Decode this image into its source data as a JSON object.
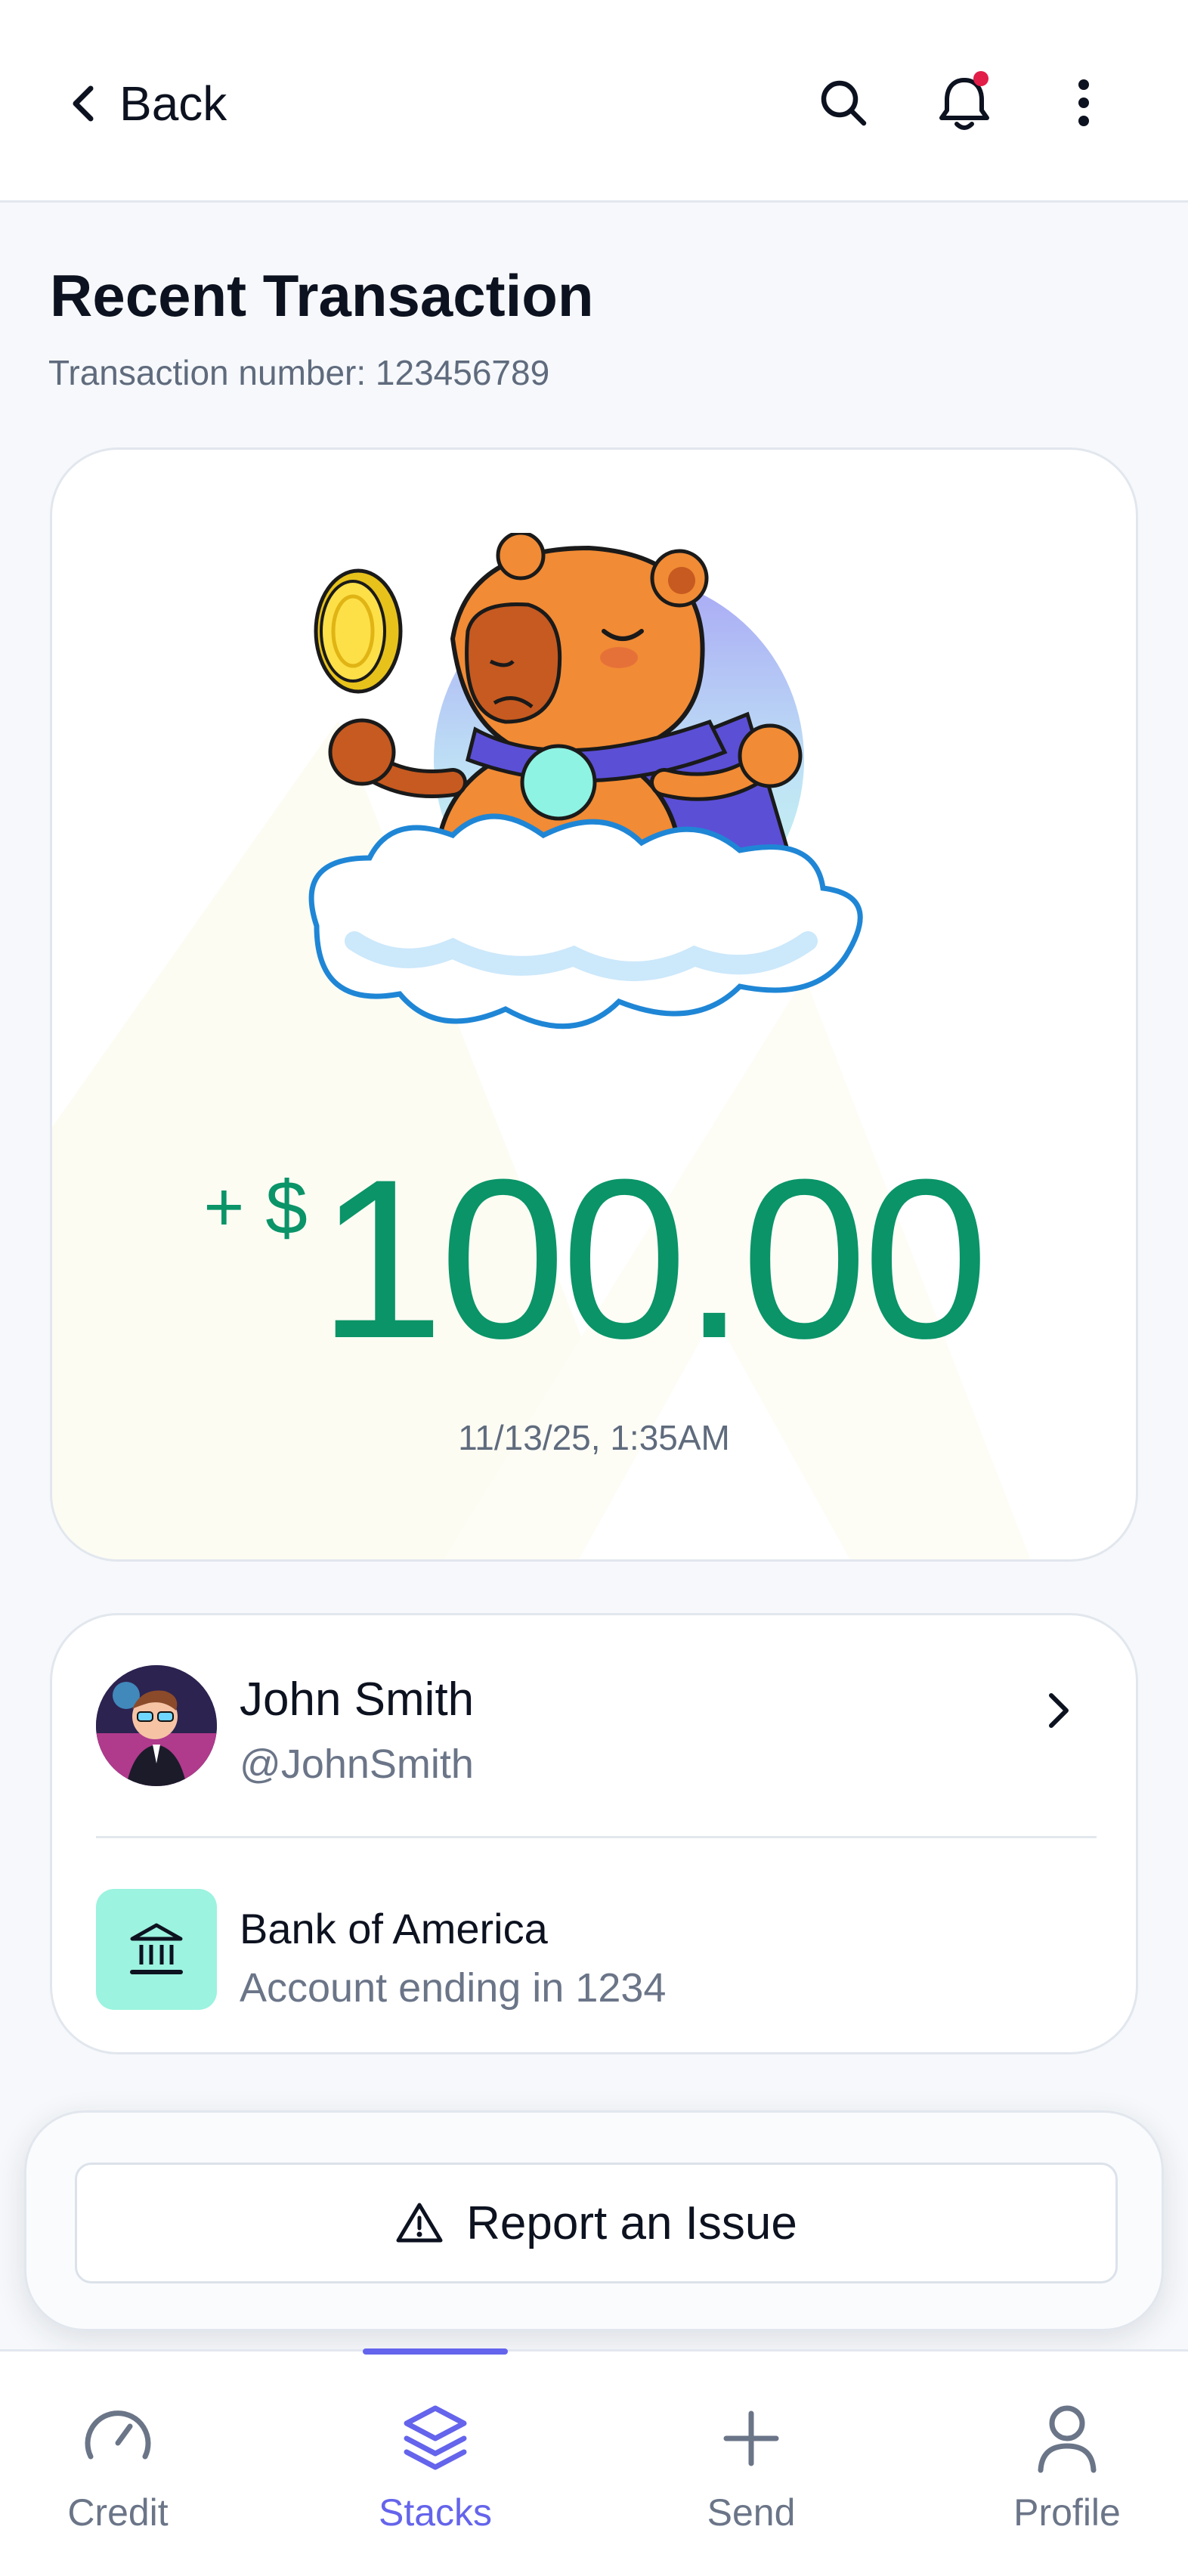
{
  "header": {
    "back_label": "Back",
    "icons": [
      "chevron-left-icon",
      "search-icon",
      "bell-icon",
      "more-vertical-icon"
    ],
    "notification_dot_color": "#e11d48"
  },
  "page": {
    "title": "Recent Transaction",
    "transaction_number": "Transaction number: 123456789"
  },
  "transaction": {
    "sign": "+",
    "currency": "$",
    "amount": "100.00",
    "datetime": "11/13/25, 1:35AM",
    "amount_color": "#0a9468"
  },
  "counterparty": {
    "name": "John Smith",
    "handle": "@JohnSmith"
  },
  "bank": {
    "name": "Bank of America",
    "account": "Account ending in 1234",
    "icon": "bank-icon",
    "icon_bg": "#9cf3df"
  },
  "report": {
    "label": "Report an Issue",
    "icon": "warning-icon"
  },
  "nav": {
    "accent": "#6464ec",
    "items": [
      {
        "label": "Credit",
        "icon": "gauge-icon"
      },
      {
        "label": "Stacks",
        "icon": "layers-icon",
        "active": true
      },
      {
        "label": "Send",
        "icon": "plus-icon"
      },
      {
        "label": "Profile",
        "icon": "user-icon"
      }
    ]
  }
}
